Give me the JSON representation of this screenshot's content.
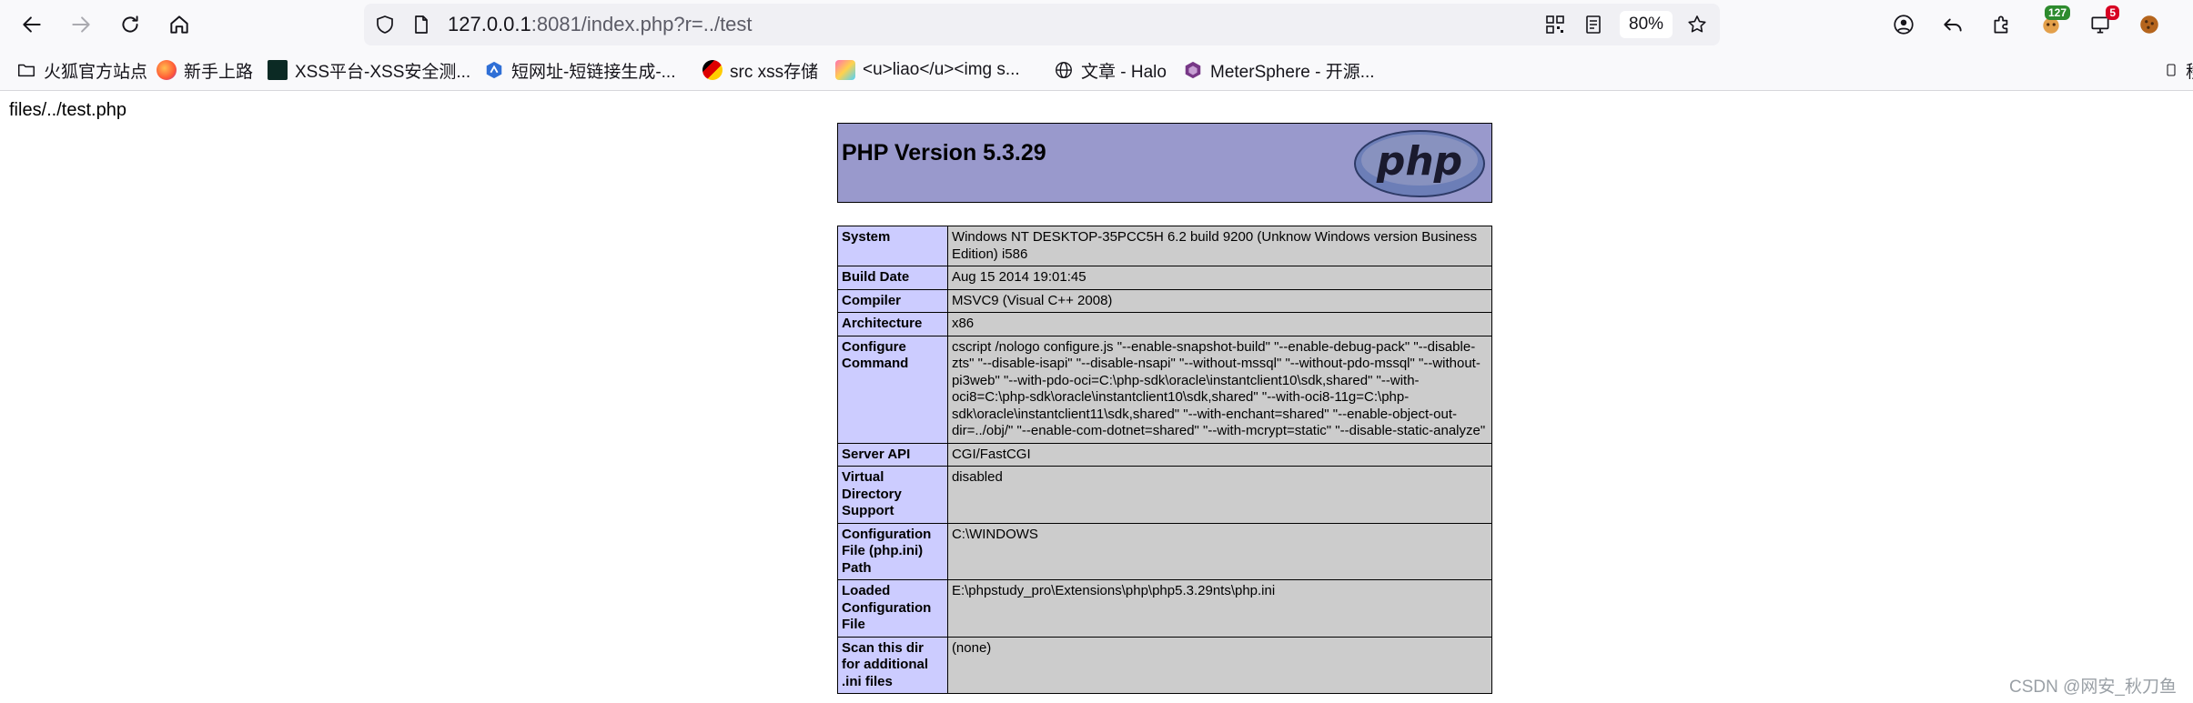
{
  "browser": {
    "url_host": "127.0.0.1",
    "url_rest": ":8081/index.php?r=../test",
    "zoom": "80%",
    "extension_badge_1": "127",
    "extension_badge_2": "5"
  },
  "bookmarks": [
    {
      "label": "火狐官方站点"
    },
    {
      "label": "新手上路"
    },
    {
      "label": "XSS平台-XSS安全测..."
    },
    {
      "label": "短网址-短链接生成-..."
    },
    {
      "label": "src  xss存储"
    },
    {
      "label": "<u>liao</u><img s..."
    },
    {
      "label": "文章 - Halo"
    },
    {
      "label": "MeterSphere - 开源..."
    },
    {
      "label": "移"
    }
  ],
  "page": {
    "path_text": "files/../test.php",
    "php_title": "PHP Version 5.3.29",
    "logo_text": "php",
    "rows": [
      {
        "key": "System",
        "value": "Windows NT DESKTOP-35PCC5H 6.2 build 9200 (Unknow Windows version Business Edition) i586"
      },
      {
        "key": "Build Date",
        "value": "Aug 15 2014 19:01:45"
      },
      {
        "key": "Compiler",
        "value": "MSVC9 (Visual C++ 2008)"
      },
      {
        "key": "Architecture",
        "value": "x86"
      },
      {
        "key": "Configure Command",
        "value": "cscript /nologo configure.js \"--enable-snapshot-build\" \"--enable-debug-pack\" \"--disable-zts\" \"--disable-isapi\" \"--disable-nsapi\" \"--without-mssql\" \"--without-pdo-mssql\" \"--without-pi3web\" \"--with-pdo-oci=C:\\php-sdk\\oracle\\instantclient10\\sdk,shared\" \"--with-oci8=C:\\php-sdk\\oracle\\instantclient10\\sdk,shared\" \"--with-oci8-11g=C:\\php-sdk\\oracle\\instantclient11\\sdk,shared\" \"--with-enchant=shared\" \"--enable-object-out-dir=../obj/\" \"--enable-com-dotnet=shared\" \"--with-mcrypt=static\" \"--disable-static-analyze\""
      },
      {
        "key": "Server API",
        "value": "CGI/FastCGI"
      },
      {
        "key": "Virtual Directory Support",
        "value": "disabled"
      },
      {
        "key": "Configuration File (php.ini) Path",
        "value": "C:\\WINDOWS"
      },
      {
        "key": "Loaded Configuration File",
        "value": "E:\\phpstudy_pro\\Extensions\\php\\php5.3.29nts\\php.ini"
      },
      {
        "key": "Scan this dir for additional .ini files",
        "value": "(none)"
      }
    ]
  },
  "watermark": "CSDN @网安_秋刀鱼"
}
